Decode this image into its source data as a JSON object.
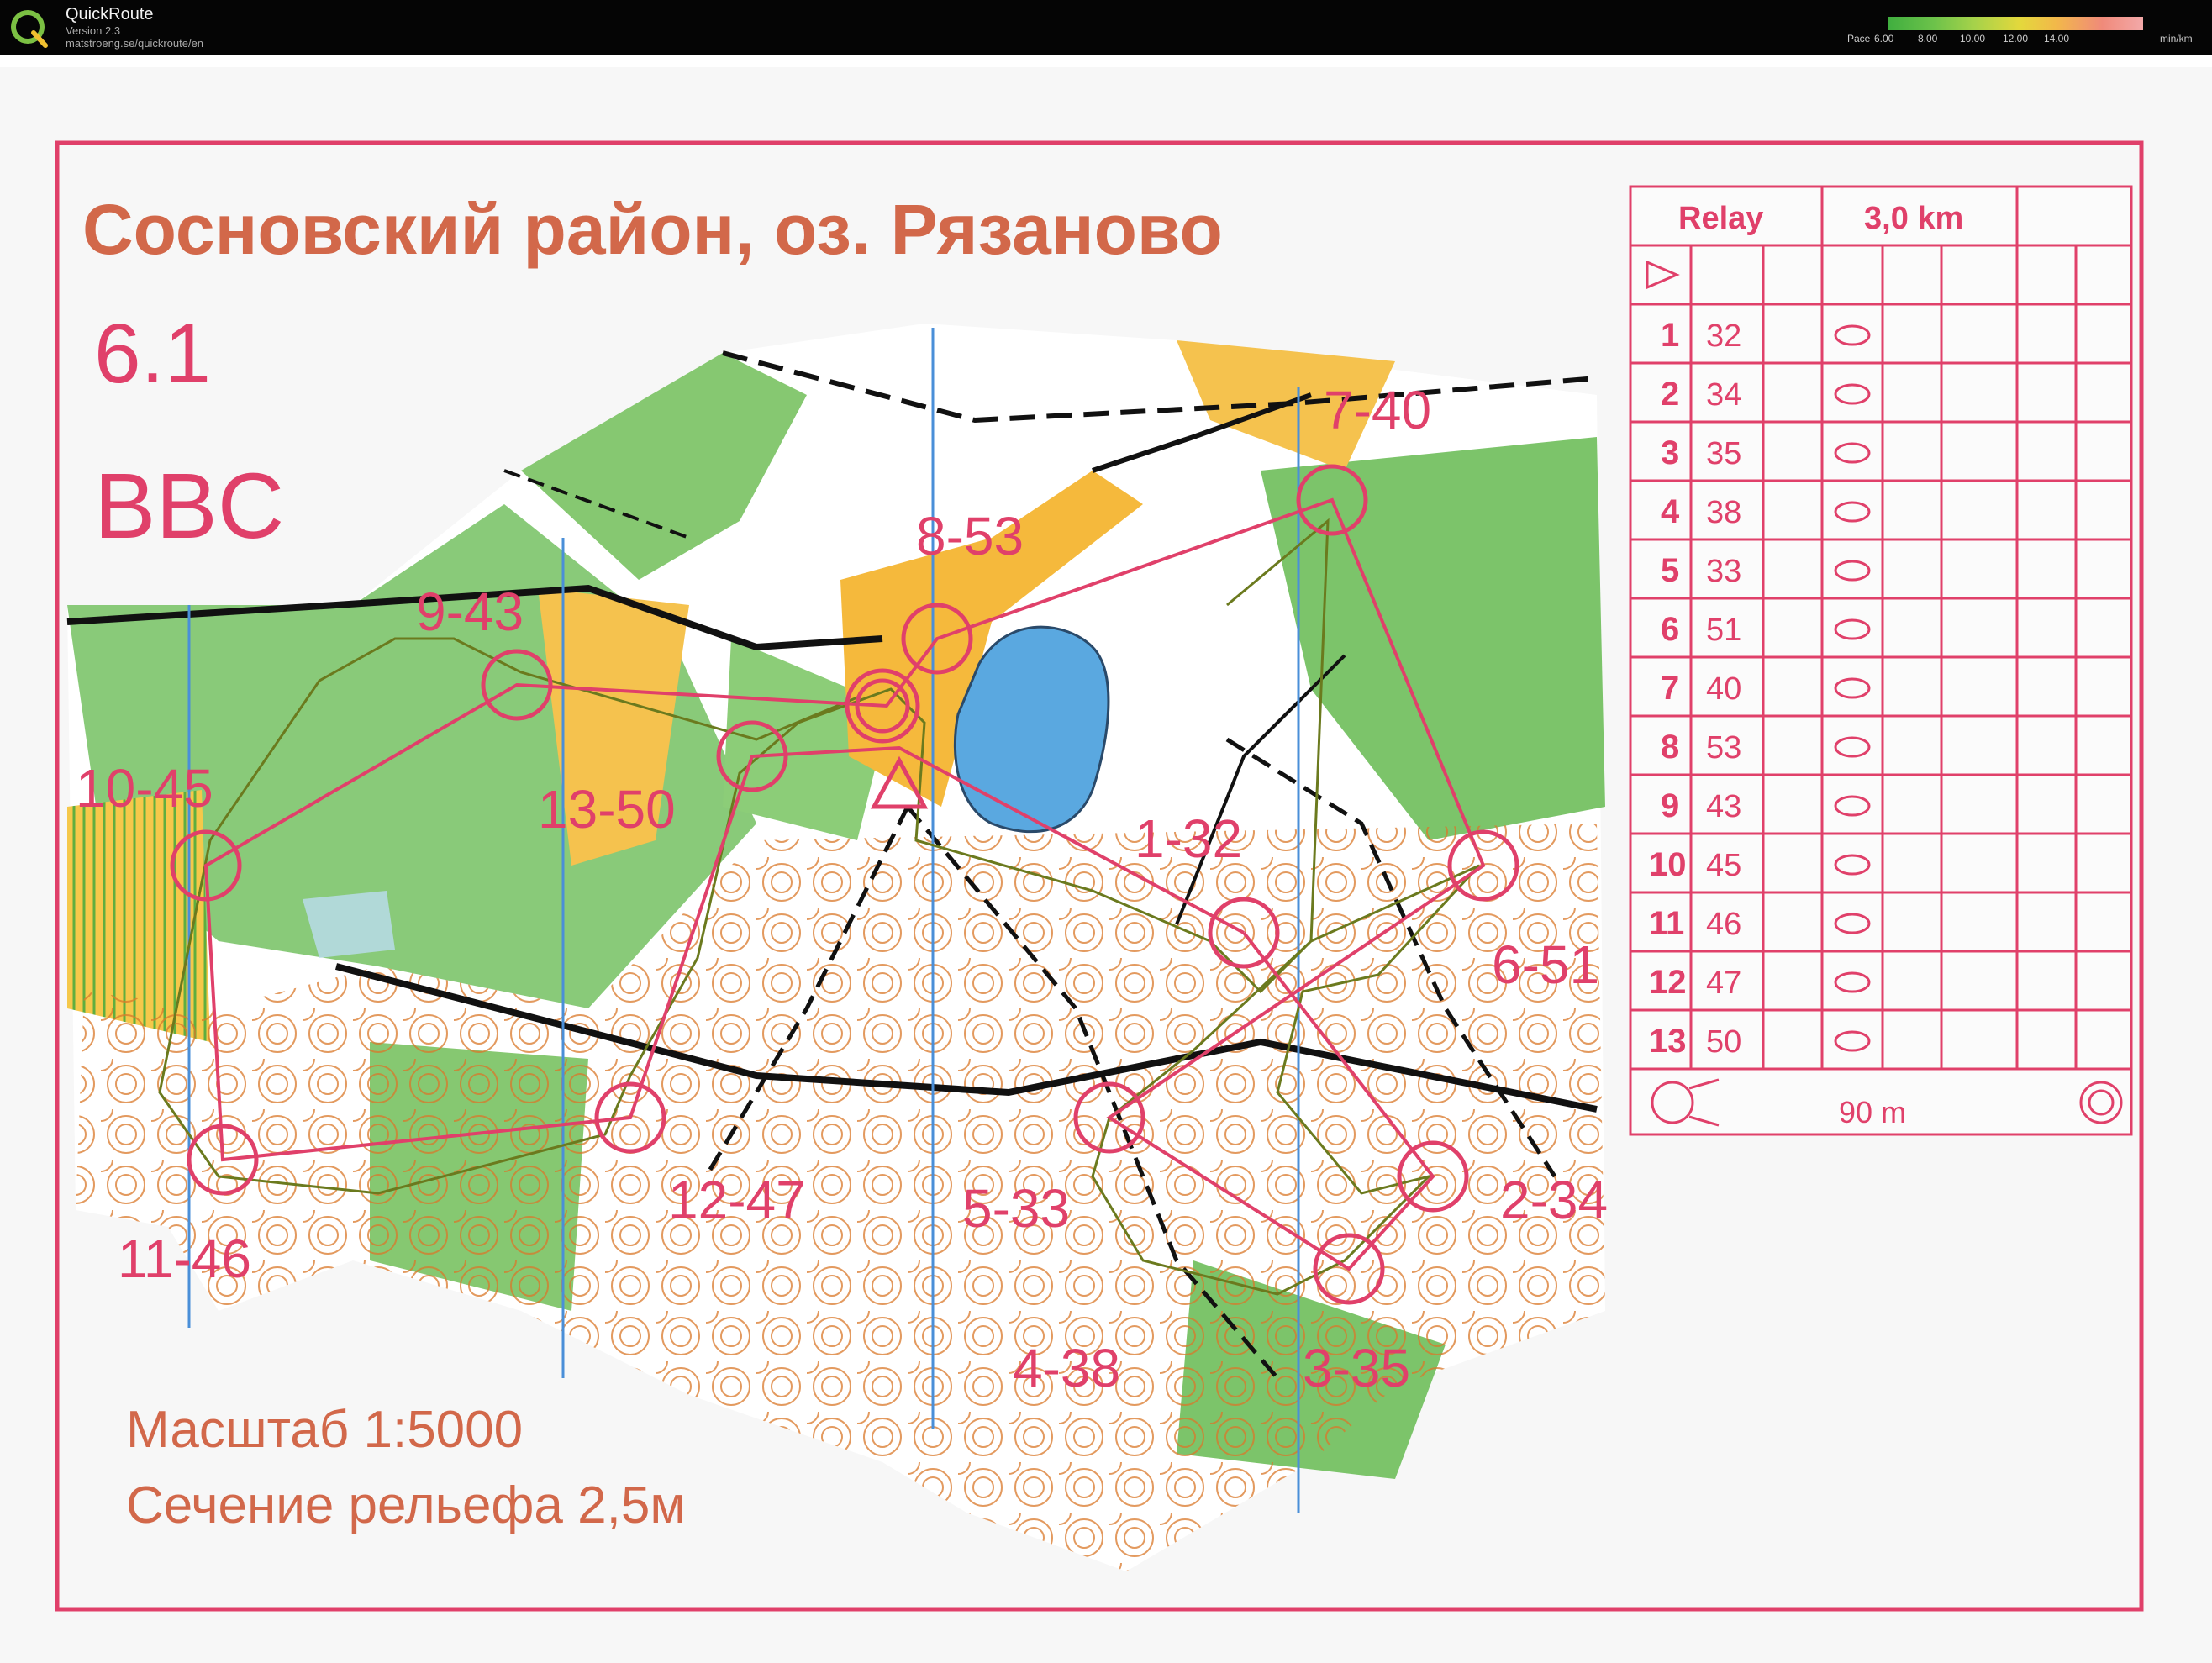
{
  "app": {
    "name": "QuickRoute",
    "version": "Version 2.3",
    "url": "matstroeng.se/quickroute/en"
  },
  "pace_legend": {
    "label": "Pace",
    "ticks": [
      "6.00",
      "8.00",
      "10.00",
      "12.00",
      "14.00"
    ],
    "unit": "min/km"
  },
  "map": {
    "title": "Сосновский район, оз. Рязаново",
    "course_number": "6.1",
    "class_name": "BBC",
    "scale_text": "Масштаб 1:5000",
    "contour_text": "Сечение рельефа 2,5м"
  },
  "control_labels": [
    "1-32",
    "2-34",
    "3-35",
    "4-38",
    "5-33",
    "6-51",
    "7-40",
    "8-53",
    "9-43",
    "10-45",
    "11-46",
    "12-47",
    "13-50"
  ],
  "description_sheet": {
    "event": "Relay",
    "length": "3,0 km",
    "finish_distance": "90 m",
    "rows": [
      {
        "num": "1",
        "code": "32"
      },
      {
        "num": "2",
        "code": "34"
      },
      {
        "num": "3",
        "code": "35"
      },
      {
        "num": "4",
        "code": "38"
      },
      {
        "num": "5",
        "code": "33"
      },
      {
        "num": "6",
        "code": "51"
      },
      {
        "num": "7",
        "code": "40"
      },
      {
        "num": "8",
        "code": "53"
      },
      {
        "num": "9",
        "code": "43"
      },
      {
        "num": "10",
        "code": "45"
      },
      {
        "num": "11",
        "code": "46"
      },
      {
        "num": "12",
        "code": "47"
      },
      {
        "num": "13",
        "code": "50"
      }
    ]
  },
  "colors": {
    "course": "#e0406a",
    "forest": "#7cc46a",
    "open": "#f5b93c",
    "water": "#5aa8e0",
    "contour": "#d9782a",
    "track": "#6b7a1e"
  }
}
